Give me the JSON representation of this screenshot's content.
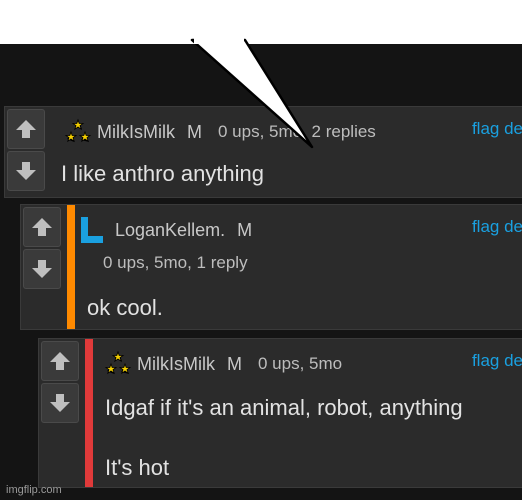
{
  "colors": {
    "link": "#1aa0e0",
    "reply_accent_1": "#ff8a00",
    "reply_accent_2": "#e03a3a",
    "background": "#141414",
    "panel": "#2b2b2b"
  },
  "comments": [
    {
      "username": "MilkIsMilk",
      "badge": "M",
      "stats": "0 ups, 5mo, 2 replies",
      "actions": "flag de",
      "body": "I like anthro anything",
      "icon": "stars-icon"
    },
    {
      "username": "LoganKellem.",
      "badge": "M",
      "stats": "0 ups, 5mo, 1 reply",
      "actions": "flag de",
      "body": "ok cool.",
      "icon": "letter-l-icon"
    },
    {
      "username": "MilkIsMilk",
      "badge": "M",
      "stats": "0 ups, 5mo",
      "actions": "flag de",
      "body_line1": "Idgaf if it's an animal, robot, anything",
      "body_line2": "It's hot",
      "icon": "stars-icon"
    }
  ],
  "watermark": "imgflip.com"
}
